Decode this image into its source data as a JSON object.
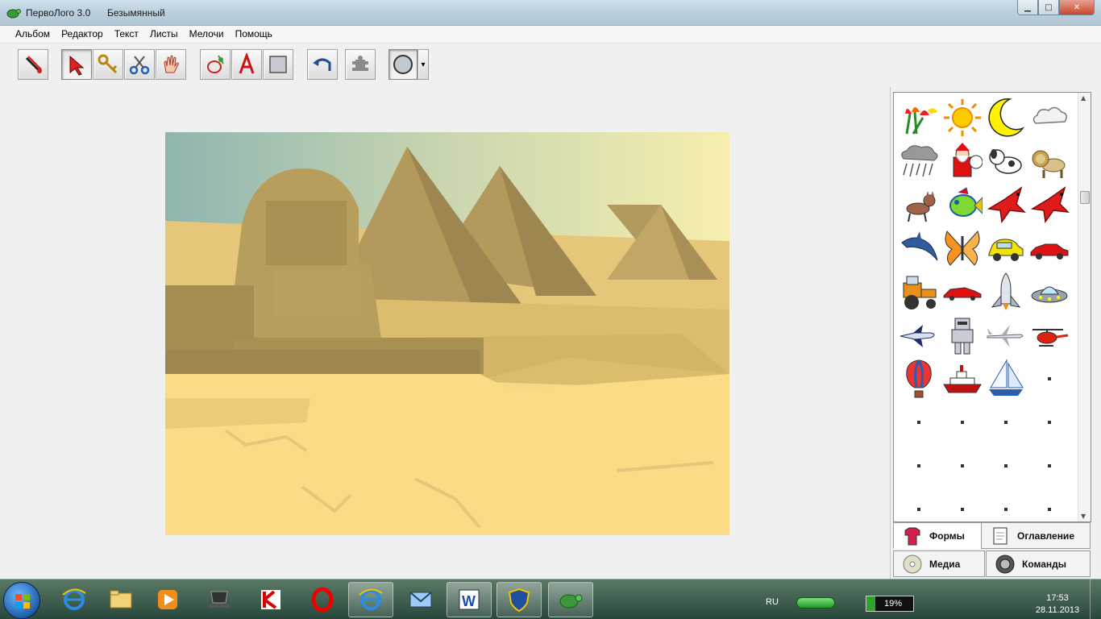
{
  "window": {
    "app_title": "ПервоЛого 3.0",
    "document_title": "Безымянный",
    "controls": {
      "minimize": "▁",
      "maximize": "□",
      "close": "✕"
    }
  },
  "menu": [
    {
      "id": "album",
      "label": "Альбом"
    },
    {
      "id": "editor",
      "label": "Редактор"
    },
    {
      "id": "text",
      "label": "Текст"
    },
    {
      "id": "sheets",
      "label": "Листы"
    },
    {
      "id": "misc",
      "label": "Мелочи"
    },
    {
      "id": "help",
      "label": "Помощь"
    }
  ],
  "toolbar": {
    "tools": [
      {
        "id": "paint",
        "icon": "brush-icon"
      },
      {
        "id": "select",
        "icon": "arrow-cursor-icon"
      },
      {
        "id": "key",
        "icon": "key-icon"
      },
      {
        "id": "scissors",
        "icon": "scissors-icon"
      },
      {
        "id": "hand",
        "icon": "hand-icon"
      },
      {
        "id": "new-turtle",
        "icon": "new-turtle-icon"
      },
      {
        "id": "text-tool",
        "icon": "letter-a-icon"
      },
      {
        "id": "rectangle",
        "icon": "gray-square-icon"
      },
      {
        "id": "undo",
        "icon": "undo-arrow-icon"
      },
      {
        "id": "stamp",
        "icon": "turtle-stamp-icon"
      },
      {
        "id": "turtle-shape",
        "icon": "circle-shape-icon"
      }
    ],
    "dropdown_arrow": "▾"
  },
  "panel": {
    "shapes": [
      "tulips-icon",
      "sun-icon",
      "moon-icon",
      "cloud-icon",
      "rain-cloud-icon",
      "santa-icon",
      "dog-icon",
      "lion-icon",
      "cat-icon",
      "fish-icon",
      "red-bird-icon",
      "red-bird-icon",
      "dolphin-icon",
      "butterfly-icon",
      "yellow-car-icon",
      "red-car-icon",
      "tractor-icon",
      "sports-car-icon",
      "space-shuttle-icon",
      "ufo-icon",
      "jet-icon",
      "robot-icon",
      "airplane-icon",
      "helicopter-icon",
      "hot-air-balloon-icon",
      "ship-icon",
      "sailboat-icon",
      "empty",
      "empty",
      "empty",
      "empty",
      "empty",
      "empty",
      "empty",
      "empty",
      "empty",
      "empty",
      "empty",
      "empty",
      "empty"
    ],
    "tabs": {
      "shapes": "Формы",
      "contents": "Оглавление",
      "media": "Медиа",
      "commands": "Команды"
    }
  },
  "taskbar": {
    "apps": [
      {
        "id": "ie",
        "icon": "internet-explorer-icon",
        "open": false
      },
      {
        "id": "explorer",
        "icon": "folder-icon",
        "open": false
      },
      {
        "id": "media",
        "icon": "media-player-icon",
        "open": false
      },
      {
        "id": "laptop",
        "icon": "laptop-icon",
        "open": false
      },
      {
        "id": "kaspersky",
        "icon": "kaspersky-icon",
        "open": false
      },
      {
        "id": "opera",
        "icon": "opera-icon",
        "open": false
      },
      {
        "id": "ie-open",
        "icon": "internet-explorer-icon",
        "open": true
      },
      {
        "id": "mail",
        "icon": "mail-icon",
        "open": false
      },
      {
        "id": "word",
        "icon": "word-icon",
        "open": true
      },
      {
        "id": "security",
        "icon": "shield-icon",
        "open": true
      },
      {
        "id": "pervologo",
        "icon": "turtle-icon",
        "open": true
      }
    ],
    "language": "RU",
    "battery_percent": "19%",
    "battery_level": 0.19,
    "time": "17:53",
    "date": "28.11.2013"
  }
}
